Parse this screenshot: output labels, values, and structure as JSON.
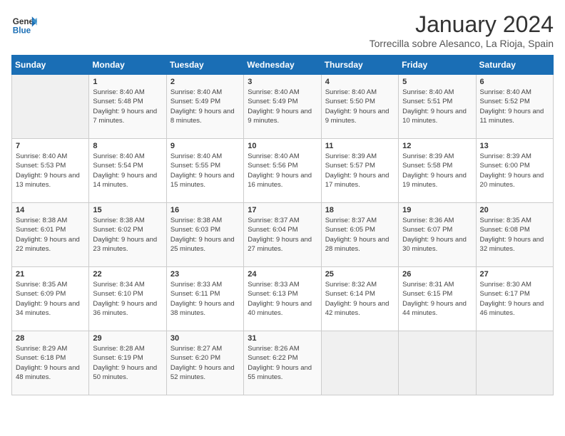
{
  "header": {
    "logo_general": "General",
    "logo_blue": "Blue",
    "month": "January 2024",
    "location": "Torrecilla sobre Alesanco, La Rioja, Spain"
  },
  "days_of_week": [
    "Sunday",
    "Monday",
    "Tuesday",
    "Wednesday",
    "Thursday",
    "Friday",
    "Saturday"
  ],
  "weeks": [
    [
      {
        "day": null
      },
      {
        "day": "1",
        "sunrise": "Sunrise: 8:40 AM",
        "sunset": "Sunset: 5:48 PM",
        "daylight": "Daylight: 9 hours and 7 minutes."
      },
      {
        "day": "2",
        "sunrise": "Sunrise: 8:40 AM",
        "sunset": "Sunset: 5:49 PM",
        "daylight": "Daylight: 9 hours and 8 minutes."
      },
      {
        "day": "3",
        "sunrise": "Sunrise: 8:40 AM",
        "sunset": "Sunset: 5:49 PM",
        "daylight": "Daylight: 9 hours and 9 minutes."
      },
      {
        "day": "4",
        "sunrise": "Sunrise: 8:40 AM",
        "sunset": "Sunset: 5:50 PM",
        "daylight": "Daylight: 9 hours and 9 minutes."
      },
      {
        "day": "5",
        "sunrise": "Sunrise: 8:40 AM",
        "sunset": "Sunset: 5:51 PM",
        "daylight": "Daylight: 9 hours and 10 minutes."
      },
      {
        "day": "6",
        "sunrise": "Sunrise: 8:40 AM",
        "sunset": "Sunset: 5:52 PM",
        "daylight": "Daylight: 9 hours and 11 minutes."
      }
    ],
    [
      {
        "day": "7",
        "sunrise": "Sunrise: 8:40 AM",
        "sunset": "Sunset: 5:53 PM",
        "daylight": "Daylight: 9 hours and 13 minutes."
      },
      {
        "day": "8",
        "sunrise": "Sunrise: 8:40 AM",
        "sunset": "Sunset: 5:54 PM",
        "daylight": "Daylight: 9 hours and 14 minutes."
      },
      {
        "day": "9",
        "sunrise": "Sunrise: 8:40 AM",
        "sunset": "Sunset: 5:55 PM",
        "daylight": "Daylight: 9 hours and 15 minutes."
      },
      {
        "day": "10",
        "sunrise": "Sunrise: 8:40 AM",
        "sunset": "Sunset: 5:56 PM",
        "daylight": "Daylight: 9 hours and 16 minutes."
      },
      {
        "day": "11",
        "sunrise": "Sunrise: 8:39 AM",
        "sunset": "Sunset: 5:57 PM",
        "daylight": "Daylight: 9 hours and 17 minutes."
      },
      {
        "day": "12",
        "sunrise": "Sunrise: 8:39 AM",
        "sunset": "Sunset: 5:58 PM",
        "daylight": "Daylight: 9 hours and 19 minutes."
      },
      {
        "day": "13",
        "sunrise": "Sunrise: 8:39 AM",
        "sunset": "Sunset: 6:00 PM",
        "daylight": "Daylight: 9 hours and 20 minutes."
      }
    ],
    [
      {
        "day": "14",
        "sunrise": "Sunrise: 8:38 AM",
        "sunset": "Sunset: 6:01 PM",
        "daylight": "Daylight: 9 hours and 22 minutes."
      },
      {
        "day": "15",
        "sunrise": "Sunrise: 8:38 AM",
        "sunset": "Sunset: 6:02 PM",
        "daylight": "Daylight: 9 hours and 23 minutes."
      },
      {
        "day": "16",
        "sunrise": "Sunrise: 8:38 AM",
        "sunset": "Sunset: 6:03 PM",
        "daylight": "Daylight: 9 hours and 25 minutes."
      },
      {
        "day": "17",
        "sunrise": "Sunrise: 8:37 AM",
        "sunset": "Sunset: 6:04 PM",
        "daylight": "Daylight: 9 hours and 27 minutes."
      },
      {
        "day": "18",
        "sunrise": "Sunrise: 8:37 AM",
        "sunset": "Sunset: 6:05 PM",
        "daylight": "Daylight: 9 hours and 28 minutes."
      },
      {
        "day": "19",
        "sunrise": "Sunrise: 8:36 AM",
        "sunset": "Sunset: 6:07 PM",
        "daylight": "Daylight: 9 hours and 30 minutes."
      },
      {
        "day": "20",
        "sunrise": "Sunrise: 8:35 AM",
        "sunset": "Sunset: 6:08 PM",
        "daylight": "Daylight: 9 hours and 32 minutes."
      }
    ],
    [
      {
        "day": "21",
        "sunrise": "Sunrise: 8:35 AM",
        "sunset": "Sunset: 6:09 PM",
        "daylight": "Daylight: 9 hours and 34 minutes."
      },
      {
        "day": "22",
        "sunrise": "Sunrise: 8:34 AM",
        "sunset": "Sunset: 6:10 PM",
        "daylight": "Daylight: 9 hours and 36 minutes."
      },
      {
        "day": "23",
        "sunrise": "Sunrise: 8:33 AM",
        "sunset": "Sunset: 6:11 PM",
        "daylight": "Daylight: 9 hours and 38 minutes."
      },
      {
        "day": "24",
        "sunrise": "Sunrise: 8:33 AM",
        "sunset": "Sunset: 6:13 PM",
        "daylight": "Daylight: 9 hours and 40 minutes."
      },
      {
        "day": "25",
        "sunrise": "Sunrise: 8:32 AM",
        "sunset": "Sunset: 6:14 PM",
        "daylight": "Daylight: 9 hours and 42 minutes."
      },
      {
        "day": "26",
        "sunrise": "Sunrise: 8:31 AM",
        "sunset": "Sunset: 6:15 PM",
        "daylight": "Daylight: 9 hours and 44 minutes."
      },
      {
        "day": "27",
        "sunrise": "Sunrise: 8:30 AM",
        "sunset": "Sunset: 6:17 PM",
        "daylight": "Daylight: 9 hours and 46 minutes."
      }
    ],
    [
      {
        "day": "28",
        "sunrise": "Sunrise: 8:29 AM",
        "sunset": "Sunset: 6:18 PM",
        "daylight": "Daylight: 9 hours and 48 minutes."
      },
      {
        "day": "29",
        "sunrise": "Sunrise: 8:28 AM",
        "sunset": "Sunset: 6:19 PM",
        "daylight": "Daylight: 9 hours and 50 minutes."
      },
      {
        "day": "30",
        "sunrise": "Sunrise: 8:27 AM",
        "sunset": "Sunset: 6:20 PM",
        "daylight": "Daylight: 9 hours and 52 minutes."
      },
      {
        "day": "31",
        "sunrise": "Sunrise: 8:26 AM",
        "sunset": "Sunset: 6:22 PM",
        "daylight": "Daylight: 9 hours and 55 minutes."
      },
      {
        "day": null
      },
      {
        "day": null
      },
      {
        "day": null
      }
    ]
  ]
}
